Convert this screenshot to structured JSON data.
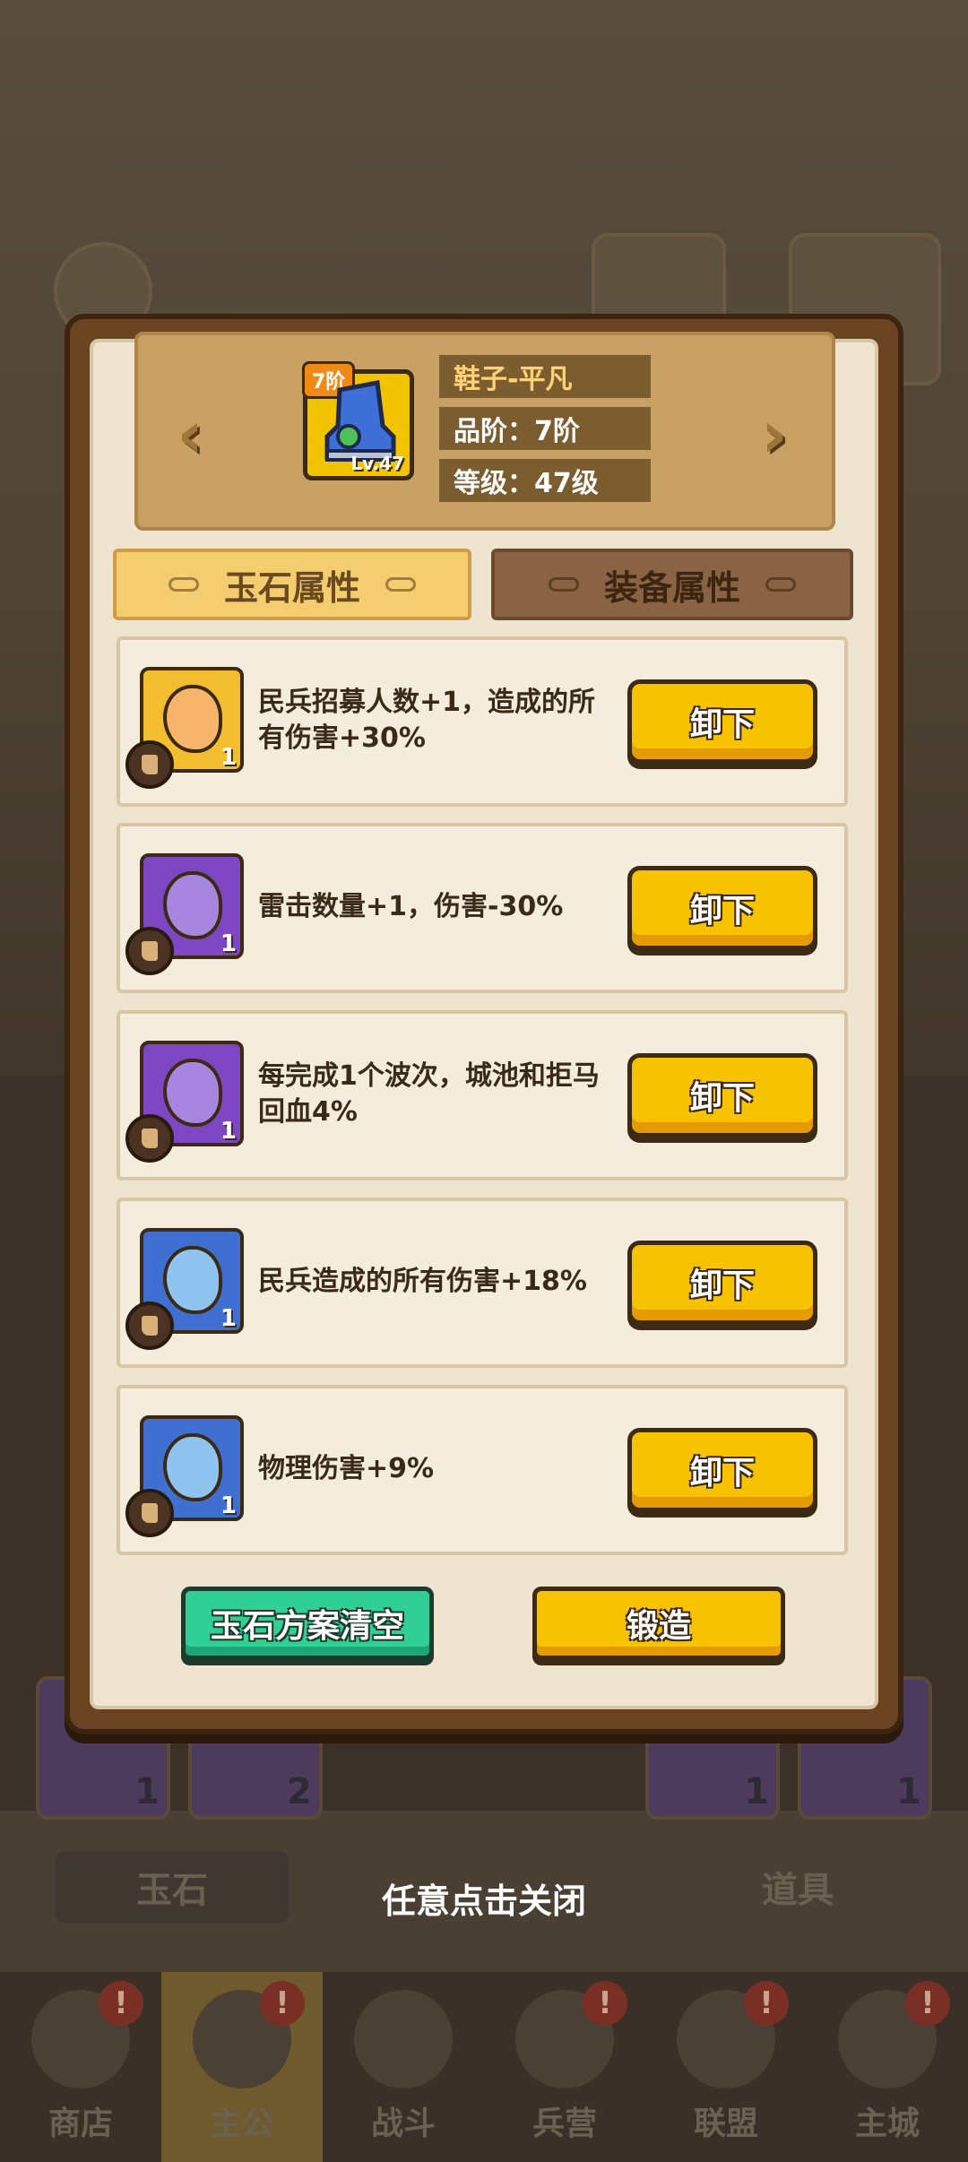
{
  "equipment": {
    "tier_badge": "7阶",
    "level_badge": "Lv.47",
    "name": "鞋子-平凡",
    "grade": "品阶：7阶",
    "level": "等级：47级"
  },
  "tabs": [
    {
      "label": "玉石属性",
      "active": true
    },
    {
      "label": "装备属性",
      "active": false
    }
  ],
  "jades": [
    {
      "color": "gold",
      "count": "1",
      "description": "民兵招募人数+1，造成的所有伤害+30%",
      "button": "卸下"
    },
    {
      "color": "purple",
      "count": "1",
      "description": "雷击数量+1，伤害-30%",
      "button": "卸下"
    },
    {
      "color": "purple",
      "count": "1",
      "description": "每完成1个波次，城池和拒马回血4%",
      "button": "卸下"
    },
    {
      "color": "blue",
      "count": "1",
      "description": "民兵造成的所有伤害+18%",
      "button": "卸下"
    },
    {
      "color": "blue",
      "count": "1",
      "description": "物理伤害+9%",
      "button": "卸下"
    }
  ],
  "actions": {
    "clear_label": "玉石方案清空",
    "forge_label": "锻造"
  },
  "close_hint": "任意点击关闭",
  "background": {
    "subtabs": [
      "玉石",
      "道具"
    ],
    "slot_counts": [
      "1",
      "2",
      "1",
      "1"
    ],
    "nav": [
      {
        "label": "商店",
        "badge": "!"
      },
      {
        "label": "主公",
        "badge": "!",
        "active": true
      },
      {
        "label": "战斗",
        "badge": ""
      },
      {
        "label": "兵营",
        "badge": "!"
      },
      {
        "label": "联盟",
        "badge": "!"
      },
      {
        "label": "主城",
        "badge": "!"
      }
    ]
  },
  "colors": {
    "button_yellow": "#f7c300",
    "button_green": "#2fcf95",
    "panel_bg": "#efe4cf",
    "frame_brown": "#6a4322"
  }
}
